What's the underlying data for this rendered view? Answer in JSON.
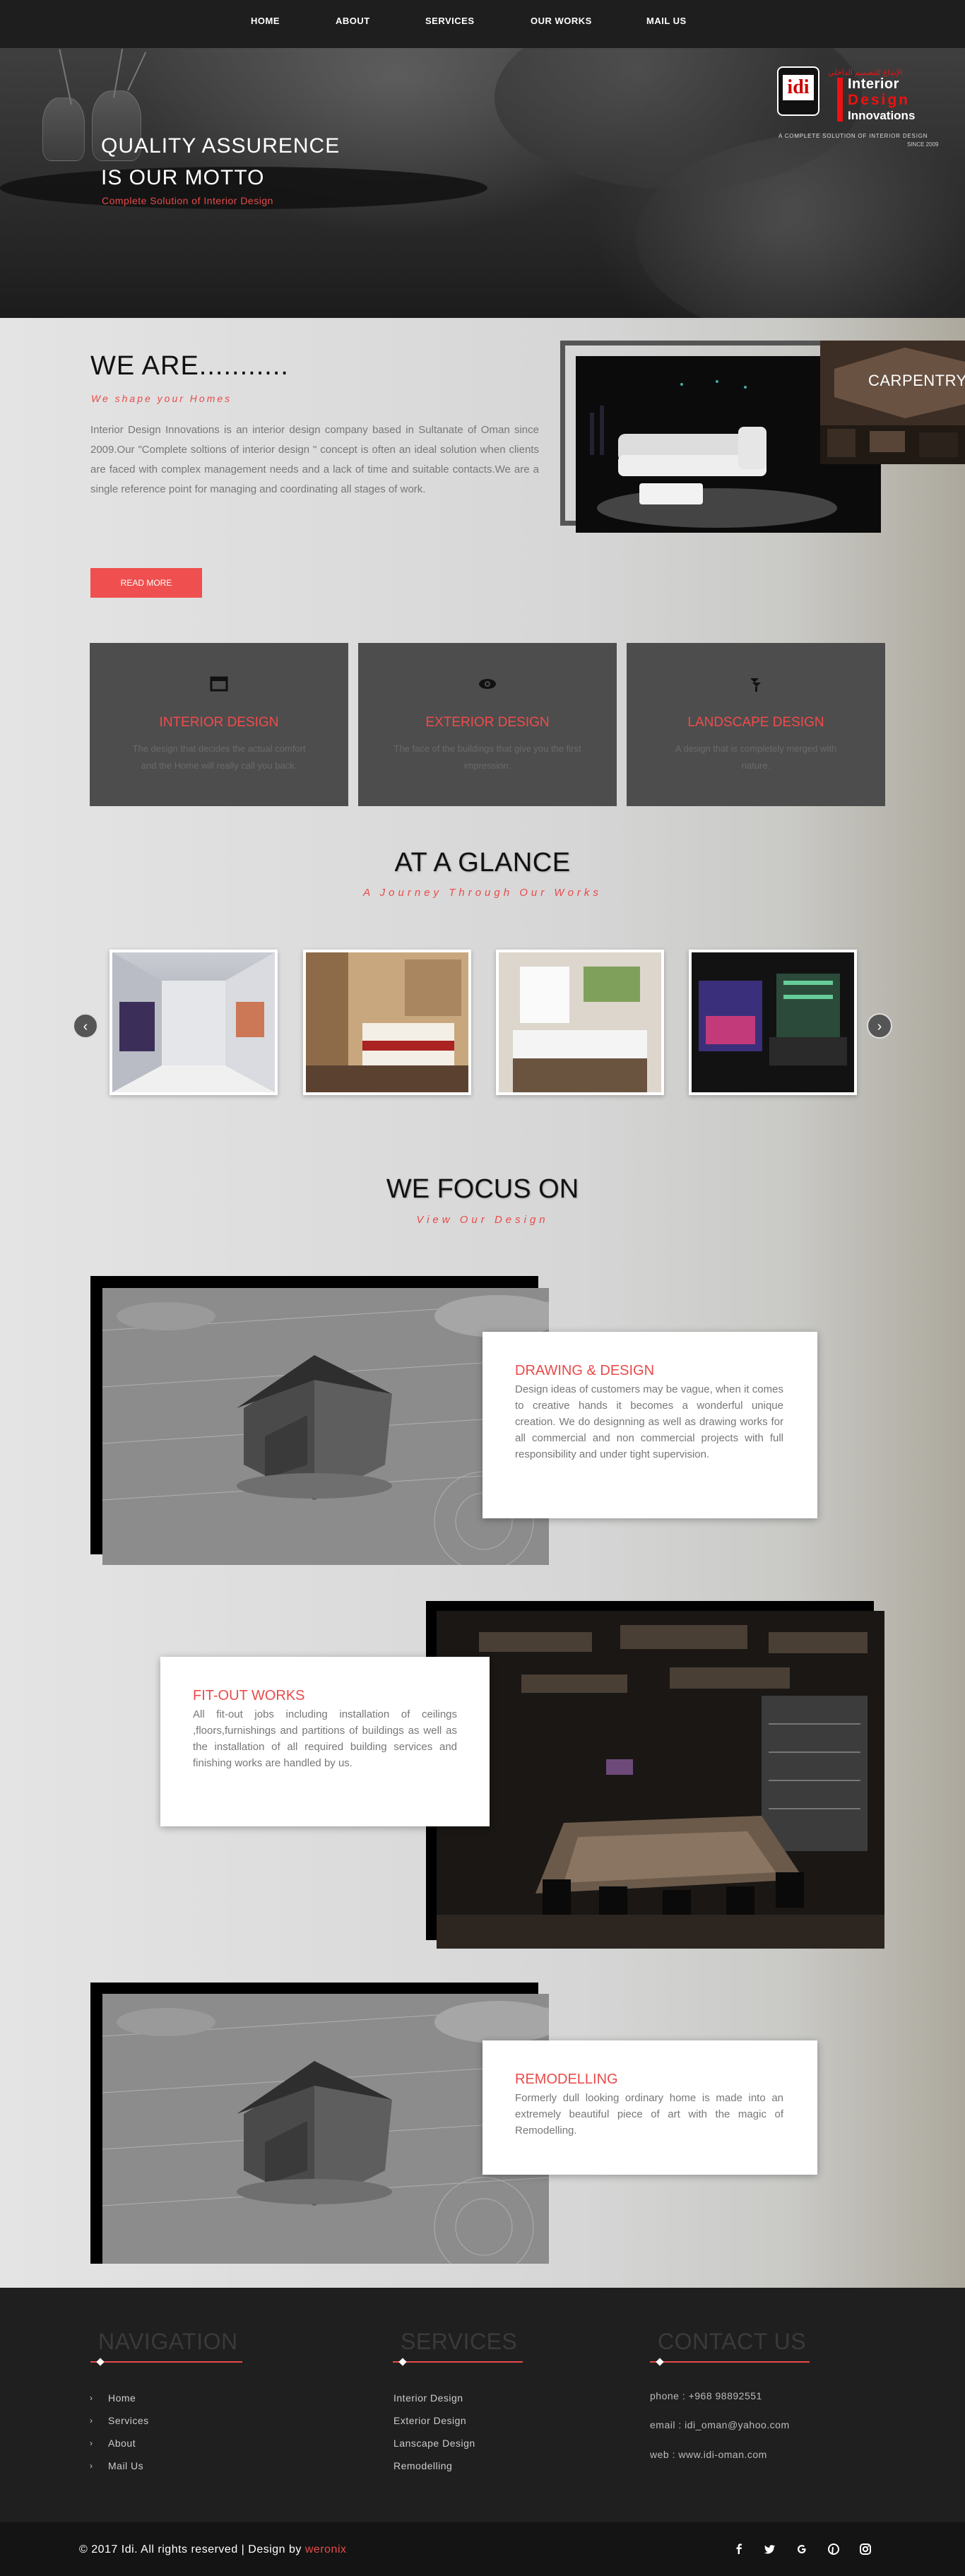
{
  "nav": {
    "items": [
      {
        "label": "HOME"
      },
      {
        "label": "ABOUT"
      },
      {
        "label": "SERVICES"
      },
      {
        "label": "OUR WORKS"
      },
      {
        "label": "MAIL US"
      }
    ]
  },
  "hero": {
    "title_line1": "QUALITY ASSURENCE",
    "title_line2": "IS OUR MOTTO",
    "subtitle": "Complete Solution of Interior Design"
  },
  "logo": {
    "mark": "idi",
    "arabic": "الإبداع للتصميم الداخلي",
    "line1": "Interior",
    "line2": "Design",
    "line3": "Innovations",
    "tagline": "A COMPLETE SOLUTION OF INTERIOR DESIGN",
    "since": "SINCE 2009"
  },
  "about": {
    "title": "WE ARE...........",
    "subtitle": "We shape your Homes",
    "text": "Interior Design Innovations is an interior design company based in Sultanate of Oman since 2009.Our \"Complete soltions of interior design \" concept is often an ideal solution when clients are faced with complex management needs and a lack of time and suitable contacts.We are a single reference point for managing and coordinating all stages of work.",
    "button": "READ MORE",
    "side_label": "CARPENTRY"
  },
  "services": [
    {
      "icon": "window-icon",
      "title": "INTERIOR DESIGN",
      "desc": "The design that decides the actual comfort and the Home will really call you back."
    },
    {
      "icon": "eye-icon",
      "title": "EXTERIOR DESIGN",
      "desc": "The face of the buildings that give you the first impression."
    },
    {
      "icon": "tree-icon",
      "title": "LANDSCAPE DESIGN",
      "desc": "A design that is completely merged with nature."
    }
  ],
  "glance": {
    "title": "AT A GLANCE",
    "subtitle": "A Journey Through Our Works",
    "prev": "‹",
    "next": "›"
  },
  "focus": {
    "title": "WE FOCUS ON",
    "subtitle": "View Our Design",
    "items": [
      {
        "title": "DRAWING & DESIGN",
        "text": "Design ideas of customers may be vague, when it comes to creative hands it becomes a wonderful unique creation. We do designning as well as drawing works for all commercial and non commercial projects with full responsibility and under tight supervision."
      },
      {
        "title": "FIT-OUT WORKS",
        "text": "All fit-out jobs including installation of ceilings ,floors,furnishings and partitions of buildings as well as the installation of all required building services and finishing works are handled by us."
      },
      {
        "title": "REMODELLING",
        "text": "Formerly dull looking ordinary home is made into an extremely beautiful piece of art with the magic of Remodelling."
      }
    ]
  },
  "footer": {
    "nav_title": "NAVIGATION",
    "services_title": "SERVICES",
    "contact_title": "CONTACT US",
    "nav_items": [
      "Home",
      "Services",
      "About",
      "Mail Us"
    ],
    "service_items": [
      "Interior Design",
      "Exterior Design",
      "Lanscape Design",
      "Remodelling"
    ],
    "phone": "phone : +968 98892551",
    "email": "email : idi_oman@yahoo.com",
    "web": "web : www.idi-oman.com",
    "copyright": "© 2017 Idi. All rights reserved | Design by ",
    "designer": "weronix"
  },
  "social": [
    "facebook-icon",
    "twitter-icon",
    "google-plus-icon",
    "pinterest-icon",
    "instagram-icon"
  ],
  "colors": {
    "accent": "#e94a4a",
    "dark": "#1f1f1f",
    "card": "#4d4d4d"
  }
}
